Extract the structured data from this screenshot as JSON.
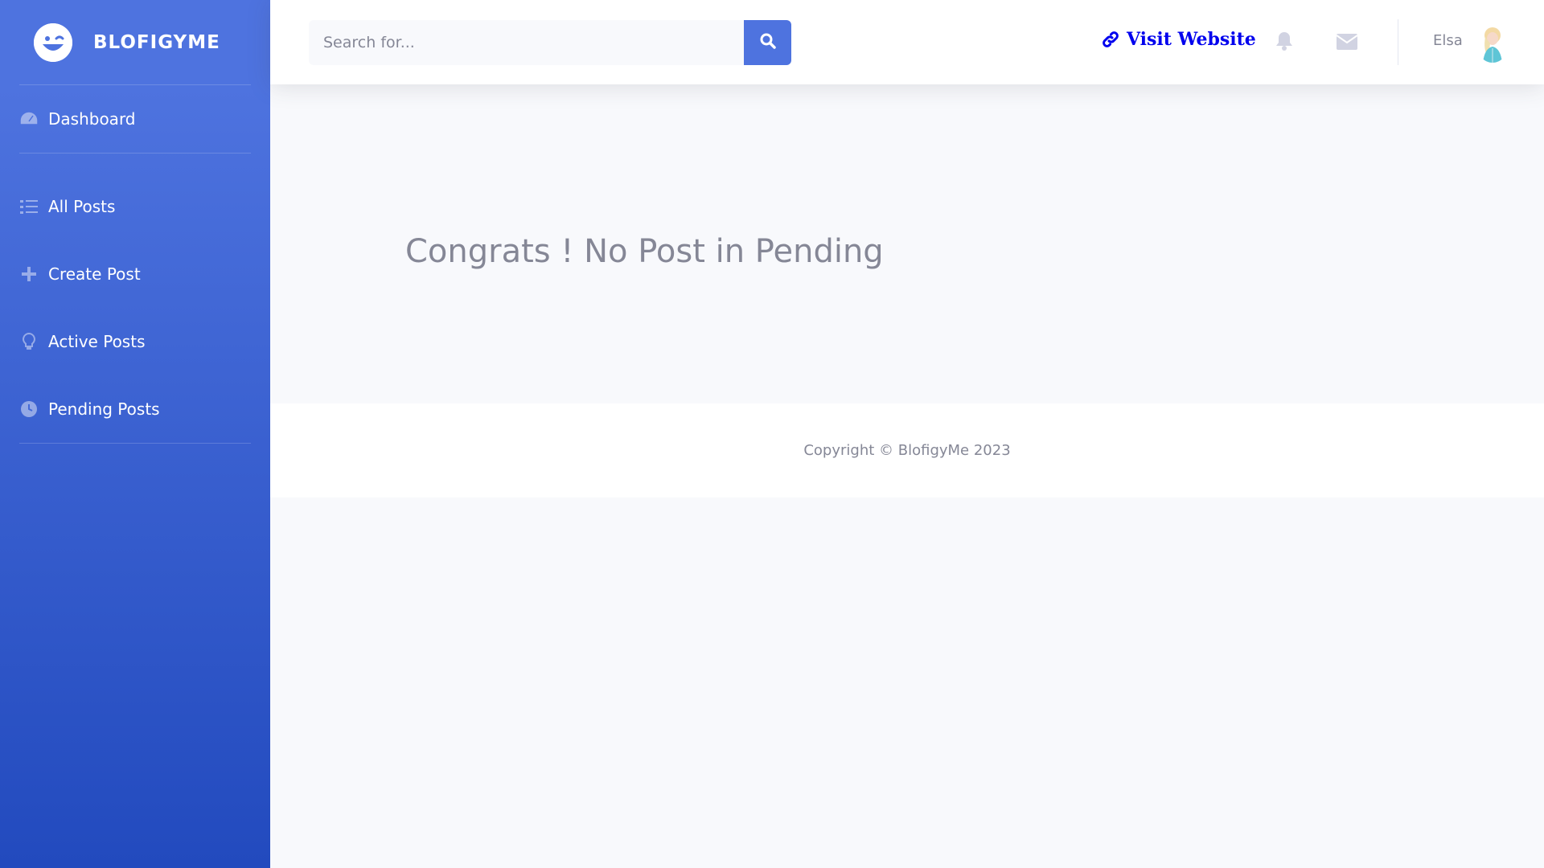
{
  "sidebar": {
    "brand": "BLOFIGYME",
    "dashboard_label": "Dashboard",
    "items": [
      {
        "label": "All Posts",
        "icon": "tasks-icon"
      },
      {
        "label": "Create Post",
        "icon": "plus-icon"
      },
      {
        "label": "Active Posts",
        "icon": "lightbulb-icon"
      },
      {
        "label": "Pending Posts",
        "icon": "clock-icon"
      }
    ]
  },
  "topbar": {
    "search_placeholder": "Search for...",
    "visit_label": "Visit Website",
    "user_name": "Elsa"
  },
  "main": {
    "message": "Congrats ! No Post in Pending"
  },
  "footer": {
    "copyright": "Copyright © BlofigyMe 2023"
  },
  "colors": {
    "primary": "#4e73df",
    "primary_dark": "#224abe",
    "link": "#0000ee",
    "text_muted": "#858796"
  }
}
